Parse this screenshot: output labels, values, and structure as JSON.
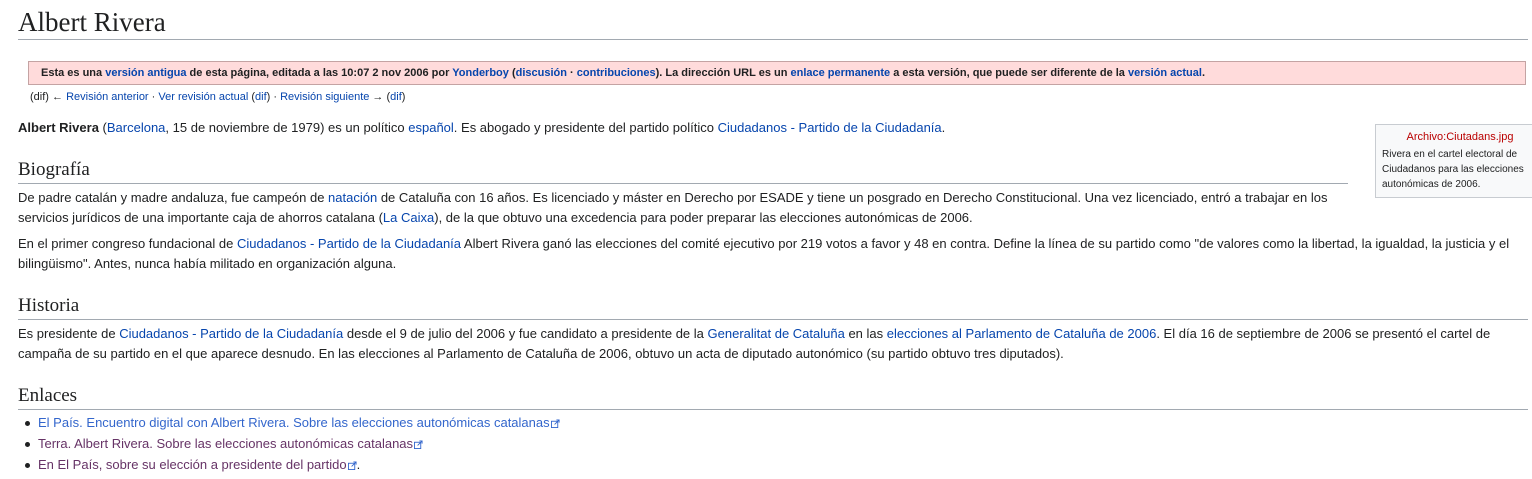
{
  "title": "Albert Rivera",
  "notice": {
    "t1": "Esta es una ",
    "l1": "versión antigua",
    "t2": " de esta página, editada a las 10:07 2 nov 2006 por ",
    "l2": "Yonderboy",
    "t3": " (",
    "l3": "discusión",
    "t4": " · ",
    "l4": "contribuciones",
    "t5": "). La dirección URL es un ",
    "l5": "enlace permanente",
    "t6": " a esta versión, que puede ser diferente de la ",
    "l6": "versión actual",
    "t7": "."
  },
  "revnav": {
    "t1": "(dif) ← ",
    "l1": "Revisión anterior",
    "t2": " · ",
    "l2": "Ver revisión actual",
    "t3": " (",
    "l3": "dif",
    "t4": ") · ",
    "l4": "Revisión siguiente",
    "t5": " → (",
    "l5": "dif",
    "t6": ")"
  },
  "intro": {
    "bold": "Albert Rivera",
    "t1": " (",
    "l1": "Barcelona",
    "t2": ", 15 de noviembre de 1979) es un político ",
    "l2": "español",
    "t3": ". Es abogado y presidente del partido político ",
    "l3": "Ciudadanos - Partido de la Ciudadanía",
    "t4": "."
  },
  "thumb": {
    "file": "Archivo:Ciutadans.jpg",
    "caption": "Rivera en el cartel electoral de Ciudadanos para las elecciones autonómicas de 2006."
  },
  "biografia": {
    "heading": "Biografía",
    "p1": {
      "t1": "De padre catalán y madre andaluza, fue campeón de ",
      "l1": "natación",
      "t2": " de Cataluña con 16 años. Es licenciado y máster en Derecho por ESADE y tiene un posgrado en Derecho Constitucional. Una vez licenciado, entró a trabajar en los servicios jurídicos de una importante caja de ahorros catalana (",
      "l2": "La Caixa",
      "t3": "), de la que obtuvo una excedencia para poder preparar las elecciones autonómicas de 2006."
    },
    "p2": {
      "t1": "En el primer congreso fundacional de ",
      "l1": "Ciudadanos - Partido de la Ciudadanía",
      "t2": " Albert Rivera ganó las elecciones del comité ejecutivo por 219 votos a favor y 48 en contra. Define la línea de su partido como \"de valores como la libertad, la igualdad, la justicia y el bilingüismo\". Antes, nunca había militado en organización alguna."
    }
  },
  "historia": {
    "heading": "Historia",
    "p": {
      "t1": "Es presidente de ",
      "l1": "Ciudadanos - Partido de la Ciudadanía",
      "t2": " desde el 9 de julio del 2006 y fue candidato a presidente de la ",
      "l2": "Generalitat de Cataluña",
      "t3": " en las ",
      "l3": "elecciones al Parlamento de Cataluña de 2006",
      "t4": ". El día 16 de septiembre de 2006 se presentó el cartel de campaña de su partido en el que aparece desnudo. En las elecciones al Parlamento de Cataluña de 2006, obtuvo un acta de diputado autonómico (su partido obtuvo tres diputados)."
    }
  },
  "enlaces": {
    "heading": "Enlaces",
    "items": [
      {
        "text": "El País. Encuentro digital con Albert Rivera. Sobre las elecciones autonómicas catalanas",
        "after": ""
      },
      {
        "text": "Terra. Albert Rivera. Sobre las elecciones autonómicas catalanas",
        "after": ""
      },
      {
        "text": "En El País, sobre su elección a presidente del partido",
        "after": "."
      }
    ]
  },
  "icons": {
    "external_link": "external-link-icon",
    "bullet": "bullet-icon"
  },
  "colors": {
    "link": "#0645ad",
    "visited": "#663366",
    "external": "#3366cc",
    "redlink": "#ba0000",
    "notice_bg": "#ffdbdb"
  }
}
